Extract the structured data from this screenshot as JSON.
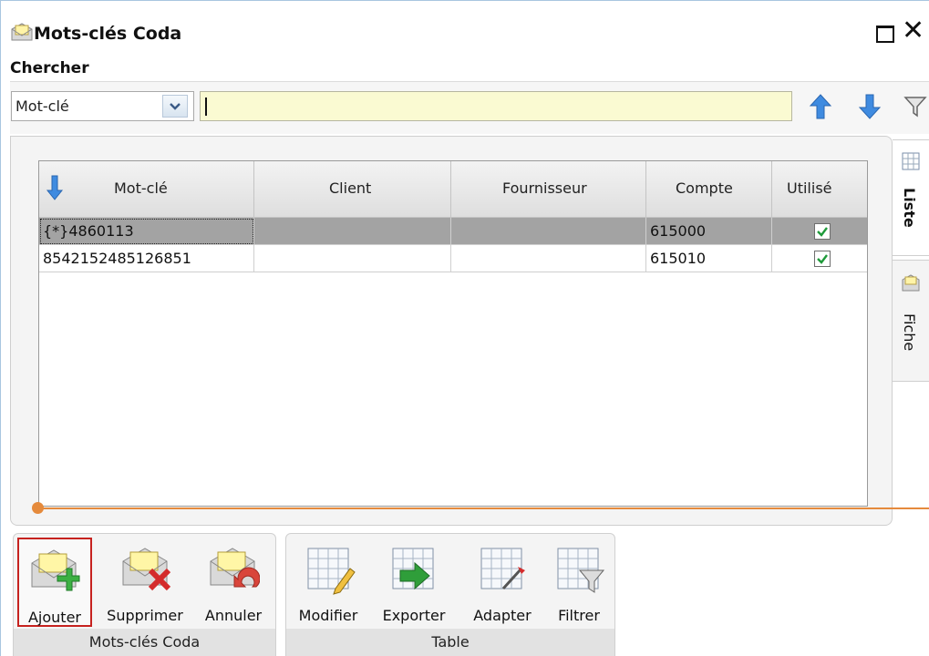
{
  "window": {
    "title": "Mots-clés Coda"
  },
  "search": {
    "label": "Chercher",
    "field_value": "Mot-clé",
    "query": ""
  },
  "grid": {
    "columns": [
      "Mot-clé",
      "Client",
      "Fournisseur",
      "Compte",
      "Utilisé"
    ],
    "rows": [
      {
        "mot_cle": "{*}4860113",
        "client": "",
        "fournisseur": "",
        "compte": "615000",
        "utilise": true,
        "selected": true
      },
      {
        "mot_cle": "8542152485126851",
        "client": "",
        "fournisseur": "",
        "compte": "615010",
        "utilise": true,
        "selected": false
      }
    ]
  },
  "side_tabs": [
    "Liste",
    "Fiche"
  ],
  "ribbon": {
    "groups": [
      {
        "label": "Mots-clés Coda",
        "buttons": [
          "Ajouter",
          "Supprimer",
          "Annuler"
        ]
      },
      {
        "label": "Table",
        "buttons": [
          "Modifier",
          "Exporter",
          "Adapter",
          "Filtrer"
        ]
      }
    ]
  },
  "colors": {
    "selection": "#a3a3a3",
    "search_bg": "#fafad2",
    "accent_orange": "#e58a3c",
    "active_outline": "#c6221f"
  }
}
